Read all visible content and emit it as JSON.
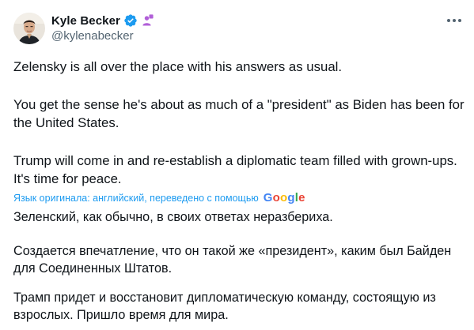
{
  "author": {
    "display_name": "Kyle Becker",
    "handle": "@kylenabecker",
    "verified_icon": "verified-badge-icon",
    "affiliate_icon": "affiliate-badge-icon"
  },
  "tweet": {
    "paragraphs": [
      "Zelensky is all over the place with his answers as usual.",
      "You get the sense he's about as much of a \"president\" as Biden has been for the United States.",
      "Trump will come in and re-establish a diplomatic team filled with grown-ups. It's time for peace."
    ]
  },
  "translation": {
    "notice": "Язык оригинала: английский, переведено с помощью",
    "provider": [
      "G",
      "o",
      "o",
      "g",
      "l",
      "e"
    ],
    "paragraphs": [
      "Зеленский, как обычно, в своих ответах неразбериха.",
      "Создается впечатление, что он такой же «президент», каким был Байден для Соединенных Штатов.",
      "Трамп придет и восстановит дипломатическую команду, состоящую из взрослых. Пришло время для мира."
    ]
  },
  "colors": {
    "link_blue": "#1d9bf0",
    "secondary_text": "#536471",
    "google": [
      "#4285F4",
      "#EA4335",
      "#FBBC05",
      "#4285F4",
      "#34A853",
      "#EA4335"
    ]
  }
}
